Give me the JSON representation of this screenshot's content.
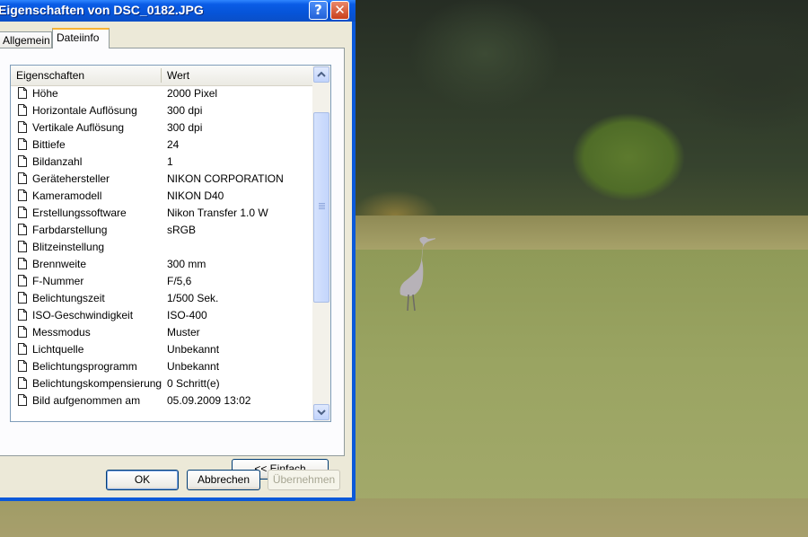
{
  "window": {
    "title": "Eigenschaften von DSC_0182.JPG",
    "help_label": "?",
    "close_label": "✕"
  },
  "tabs": [
    {
      "label": "Allgemein",
      "active": false
    },
    {
      "label": "Dateiinfo",
      "active": true
    }
  ],
  "list": {
    "col_property": "Eigenschaften",
    "col_value": "Wert",
    "rows": [
      {
        "name": "Höhe",
        "value": "2000 Pixel"
      },
      {
        "name": "Horizontale Auflösung",
        "value": "300 dpi"
      },
      {
        "name": "Vertikale Auflösung",
        "value": "300 dpi"
      },
      {
        "name": "Bittiefe",
        "value": "24"
      },
      {
        "name": "Bildanzahl",
        "value": "1"
      },
      {
        "name": "Gerätehersteller",
        "value": "NIKON CORPORATION"
      },
      {
        "name": "Kameramodell",
        "value": "NIKON D40"
      },
      {
        "name": "Erstellungssoftware",
        "value": "Nikon Transfer 1.0 W"
      },
      {
        "name": "Farbdarstellung",
        "value": "sRGB"
      },
      {
        "name": "Blitzeinstellung",
        "value": ""
      },
      {
        "name": "Brennweite",
        "value": "300 mm"
      },
      {
        "name": "F-Nummer",
        "value": "F/5,6"
      },
      {
        "name": "Belichtungszeit",
        "value": "1/500 Sek."
      },
      {
        "name": "ISO-Geschwindigkeit",
        "value": "ISO-400"
      },
      {
        "name": "Messmodus",
        "value": "Muster"
      },
      {
        "name": "Lichtquelle",
        "value": "Unbekannt"
      },
      {
        "name": "Belichtungsprogramm",
        "value": "Unbekannt"
      },
      {
        "name": "Belichtungskompensierung",
        "value": "0 Schritt(e)"
      },
      {
        "name": "Bild aufgenommen am",
        "value": "05.09.2009 13:02"
      }
    ]
  },
  "buttons": {
    "simple": "<< Einfach",
    "ok": "OK",
    "cancel": "Abbrechen",
    "apply": "Übernehmen"
  },
  "colors": {
    "titlebar": "#0654d8",
    "dialog_bg": "#ece9d8",
    "active_tab_accent": "#f8b334",
    "close_red": "#c9401c"
  },
  "icons": [
    "help-icon",
    "close-icon",
    "document-icon",
    "scroll-up-arrow-icon",
    "scroll-down-arrow-icon"
  ]
}
